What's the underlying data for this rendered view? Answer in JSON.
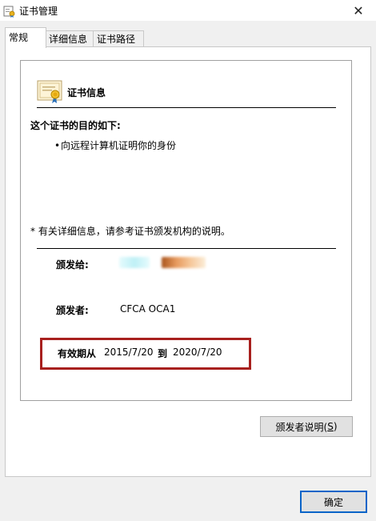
{
  "window": {
    "title": "证书管理"
  },
  "tabs": [
    {
      "label": "常规"
    },
    {
      "label": "详细信息"
    },
    {
      "label": "证书路径"
    }
  ],
  "cert": {
    "info_title": "证书信息",
    "purpose_heading": "这个证书的目的如下:",
    "purposes": [
      "向远程计算机证明你的身份"
    ],
    "note": "* 有关详细信息，请参考证书颁发机构的说明。",
    "issued_to_label": "颁发给:",
    "issuer_label": "颁发者:",
    "issuer_value": "CFCA OCA1",
    "valid_from_label": "有效期从",
    "valid_from": "2015/7/20",
    "to_label": "到",
    "valid_to": "2020/7/20"
  },
  "buttons": {
    "issuer_statement": "颁发者说明(",
    "issuer_statement_key": "S",
    "issuer_statement_end": ")",
    "ok": "确定"
  },
  "colors": {
    "highlight_border": "#a8201e",
    "ok_border": "#0a64c8"
  }
}
